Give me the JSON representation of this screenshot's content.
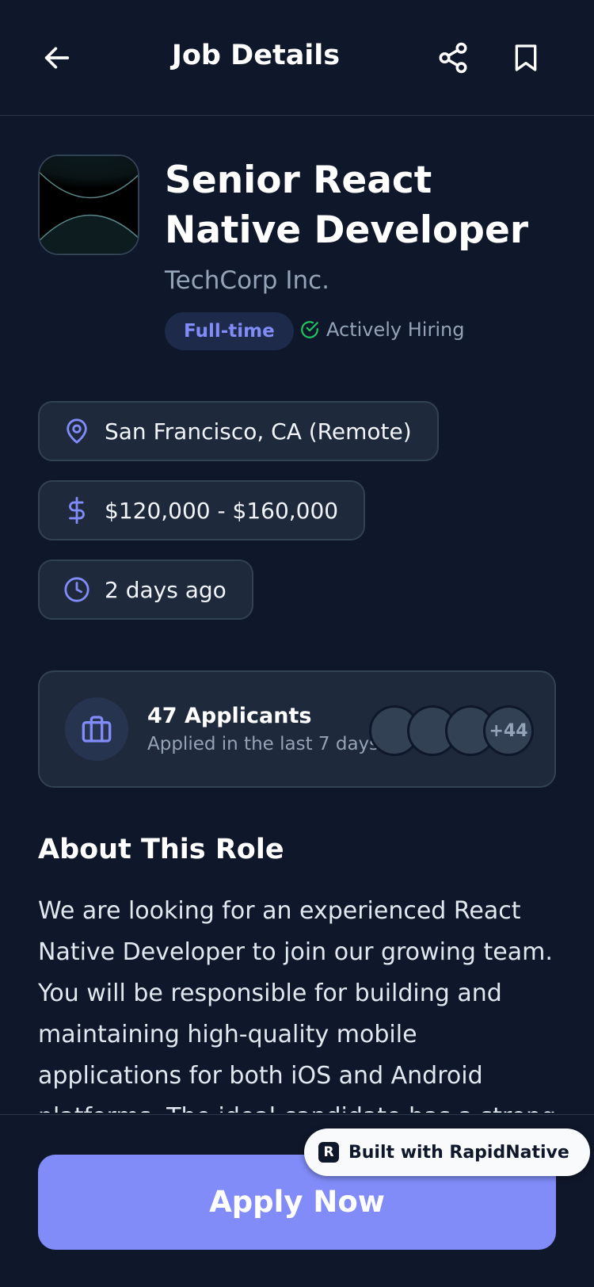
{
  "header": {
    "title": "Job Details",
    "back_icon": "arrow-left-icon",
    "share_icon": "share-icon",
    "bookmark_icon": "bookmark-icon"
  },
  "job": {
    "title": "Senior React Native Developer",
    "company": "TechCorp Inc.",
    "type": "Full-time",
    "status": "Actively Hiring",
    "logo_icon": "company-logo"
  },
  "details": [
    {
      "icon": "location-pin-icon",
      "text": "San Francisco, CA (Remote)"
    },
    {
      "icon": "dollar-icon",
      "text": "$120,000 - $160,000"
    },
    {
      "icon": "clock-icon",
      "text": "2 days ago"
    }
  ],
  "applicants": {
    "title": "47 Applicants",
    "subtitle": "Applied in the last 7 days",
    "more": "+44",
    "icon": "briefcase-icon"
  },
  "about": {
    "title": "About This Role",
    "text": "We are looking for an experienced React Native Developer to join our growing team. You will be responsible for building and maintaining high-quality mobile applications for both iOS and Android platforms. The ideal candidate has a strong"
  },
  "footer": {
    "apply_label": "Apply Now"
  },
  "badge": {
    "logo_letter": "R",
    "text": "Built with RapidNative"
  },
  "colors": {
    "background": "#0f172a",
    "card": "#1e293b",
    "accent": "#818cf8",
    "success": "#22c55e",
    "muted": "#94a3b8"
  }
}
